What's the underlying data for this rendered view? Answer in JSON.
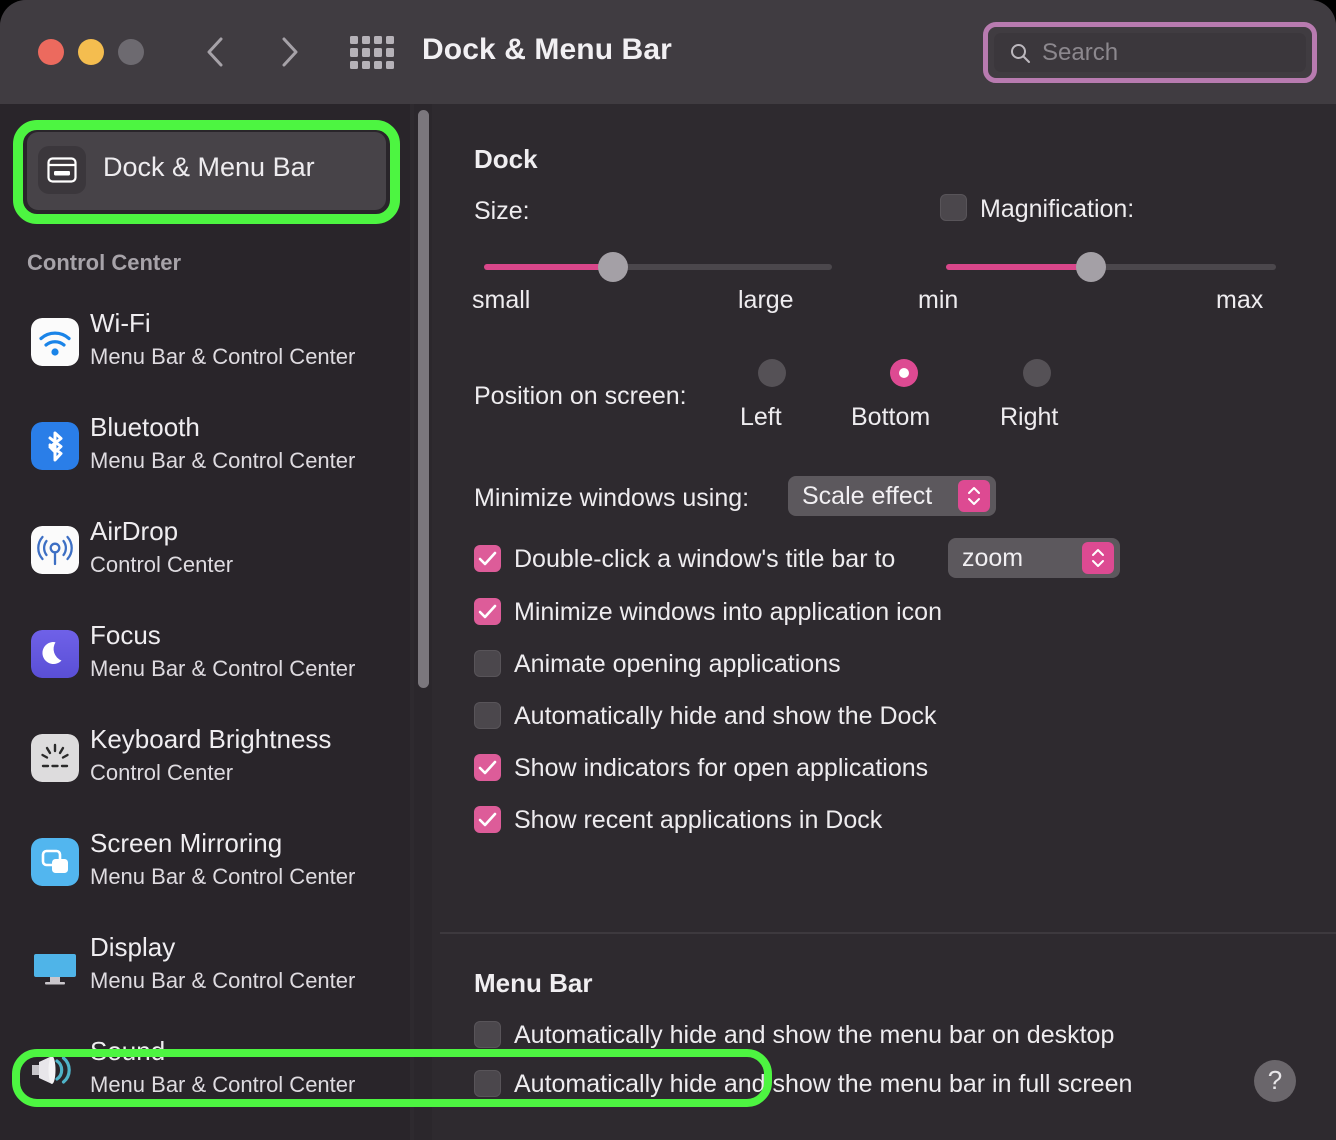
{
  "window": {
    "title": "Dock & Menu Bar",
    "traffic_lights": [
      "close-red",
      "minimize-yellow",
      "zoom-gray-disabled"
    ],
    "nav": {
      "back_icon": "chevron-left-icon",
      "forward_icon": "chevron-right-icon"
    },
    "grid_icon": "show-all-grid-icon"
  },
  "search": {
    "placeholder": "Search",
    "value": "",
    "icon": "search-icon",
    "highlight_color": "#b87bb0"
  },
  "sidebar": {
    "selected": {
      "label": "Dock & Menu Bar",
      "icon": "dock-window-icon",
      "highlight_color": "#4df541"
    },
    "group_header": "Control Center",
    "items": [
      {
        "title": "Wi-Fi",
        "subtitle": "Menu Bar & Control Center",
        "icon": "wifi-icon"
      },
      {
        "title": "Bluetooth",
        "subtitle": "Menu Bar & Control Center",
        "icon": "bluetooth-icon"
      },
      {
        "title": "AirDrop",
        "subtitle": "Control Center",
        "icon": "airdrop-icon"
      },
      {
        "title": "Focus",
        "subtitle": "Menu Bar & Control Center",
        "icon": "moon-focus-icon"
      },
      {
        "title": "Keyboard Brightness",
        "subtitle": "Control Center",
        "icon": "keyboard-brightness-icon"
      },
      {
        "title": "Screen Mirroring",
        "subtitle": "Menu Bar & Control Center",
        "icon": "screen-mirroring-icon"
      },
      {
        "title": "Display",
        "subtitle": "Menu Bar & Control Center",
        "icon": "display-icon"
      },
      {
        "title": "Sound",
        "subtitle": "Menu Bar & Control Center",
        "icon": "sound-speaker-icon"
      }
    ]
  },
  "dock_section": {
    "header": "Dock",
    "size": {
      "label": "Size:",
      "min_label": "small",
      "max_label": "large",
      "value_percent": 37
    },
    "magnification": {
      "label": "Magnification:",
      "checked": false,
      "min_label": "min",
      "max_label": "max",
      "value_percent": 44
    },
    "position": {
      "label": "Position on screen:",
      "options": [
        "Left",
        "Bottom",
        "Right"
      ],
      "selected": "Bottom"
    },
    "minimize_effect": {
      "label": "Minimize windows using:",
      "value": "Scale effect"
    },
    "double_click": {
      "label": "Double-click a window's title bar to",
      "checked": true,
      "value": "zoom"
    },
    "checkboxes": [
      {
        "label": "Minimize windows into application icon",
        "checked": true
      },
      {
        "label": "Animate opening applications",
        "checked": false
      },
      {
        "label": "Automatically hide and show the Dock",
        "checked": false
      },
      {
        "label": "Show indicators for open applications",
        "checked": true
      },
      {
        "label": "Show recent applications in Dock",
        "checked": true
      }
    ]
  },
  "menubar_section": {
    "header": "Menu Bar",
    "checkboxes": [
      {
        "label": "Automatically hide and show the menu bar on desktop",
        "checked": false,
        "highlighted": false
      },
      {
        "label": "Automatically hide and show the menu bar in full screen",
        "checked": false,
        "highlighted": true
      }
    ]
  },
  "help_button": {
    "label": "?"
  },
  "colors": {
    "accent_pink": "#dd4a92",
    "highlight_green": "#4df541",
    "highlight_purple": "#b87bb0",
    "window_bg": "#2e2a2f",
    "sidebar_bg": "#29252a",
    "titlebar_bg": "#403c41"
  }
}
